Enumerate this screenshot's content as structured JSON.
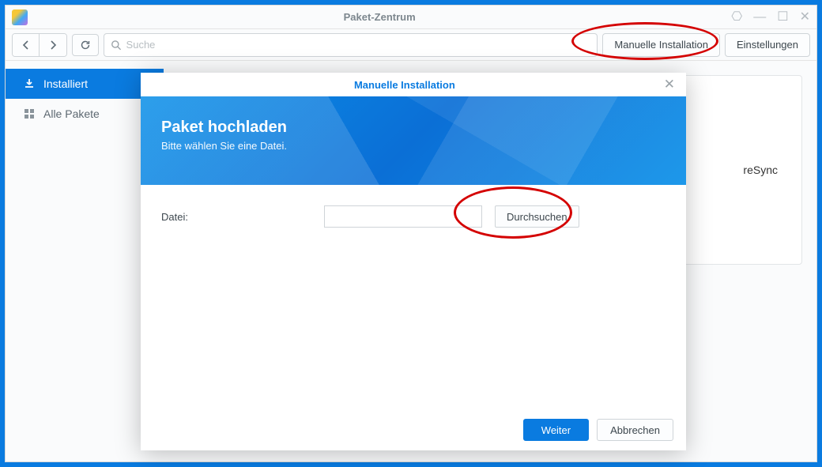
{
  "window": {
    "title": "Paket-Zentrum"
  },
  "toolbar": {
    "search_placeholder": "Suche",
    "manual_install": "Manuelle Installation",
    "settings": "Einstellungen"
  },
  "sidebar": {
    "installed": "Installiert",
    "all_packages": "Alle Pakete"
  },
  "card": {
    "partial_text": "reSync"
  },
  "modal": {
    "title": "Manuelle Installation",
    "banner_heading": "Paket hochladen",
    "banner_sub": "Bitte wählen Sie eine Datei.",
    "file_label": "Datei:",
    "browse": "Durchsuchen",
    "next": "Weiter",
    "cancel": "Abbrechen"
  }
}
